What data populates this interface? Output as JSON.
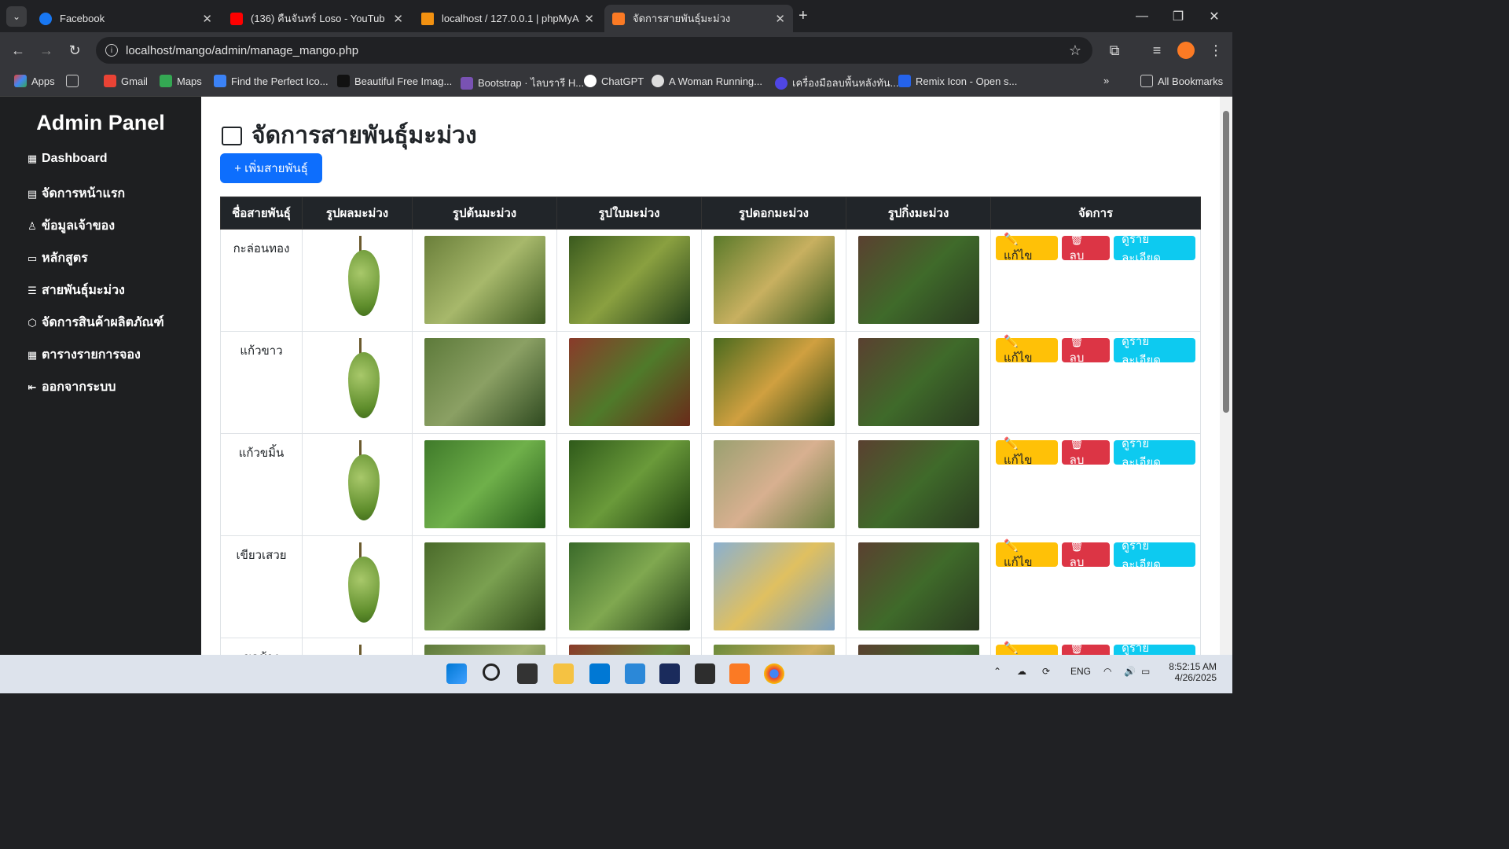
{
  "browser": {
    "tabs": [
      {
        "title": "Facebook",
        "color": "#1877f2"
      },
      {
        "title": "(136) คืนจันทร์ Loso - YouTub",
        "color": "#ff0000"
      },
      {
        "title": "localhost / 127.0.0.1 | phpMyAd",
        "color": "#f29111"
      },
      {
        "title": "จัดการสายพันธุ์มะม่วง",
        "color": "#fb7a24"
      }
    ],
    "url": "localhost/mango/admin/manage_mango.php",
    "bookmarks": [
      "Apps",
      "Gmail",
      "Maps",
      "Find the Perfect Ico...",
      "Beautiful Free Imag...",
      "Bootstrap · ไลบรารี H...",
      "ChatGPT",
      "A Woman Running...",
      "เครื่องมือลบพื้นหลังทัน...",
      "Remix Icon - Open s..."
    ],
    "all_bookmarks": "All Bookmarks"
  },
  "sidebar": {
    "title": "Admin Panel",
    "items": [
      "Dashboard",
      "จัดการหน้าแรก",
      "ข้อมูลเจ้าของ",
      "หลักสูตร",
      "สายพันธุ์มะม่วง",
      "จัดการสินค้าผลิตภัณฑ์",
      "ตารางรายการจอง",
      "ออกจากระบบ"
    ]
  },
  "page": {
    "title": "จัดการสายพันธุ์มะม่วง",
    "add_button": "+ เพิ่มสายพันธุ์",
    "columns": [
      "ชื่อสายพันธุ์",
      "รูปผลมะม่วง",
      "รูปต้นมะม่วง",
      "รูปใบมะม่วง",
      "รูปดอกมะม่วง",
      "รูปกิ่งมะม่วง",
      "จัดการ"
    ],
    "rows": [
      {
        "name": "กะล่อนทอง"
      },
      {
        "name": "แก้วขาว"
      },
      {
        "name": "แก้วขมิ้น"
      },
      {
        "name": "เขียวเสวย"
      },
      {
        "name": "ขอช้าง"
      }
    ],
    "actions": {
      "edit": "✏️ แก้ไข",
      "delete": "🗑 ลบ",
      "detail": "ดูรายละเอียด"
    }
  },
  "taskbar": {
    "lang": "ENG",
    "time": "8:52:15 AM",
    "date": "4/26/2025"
  }
}
